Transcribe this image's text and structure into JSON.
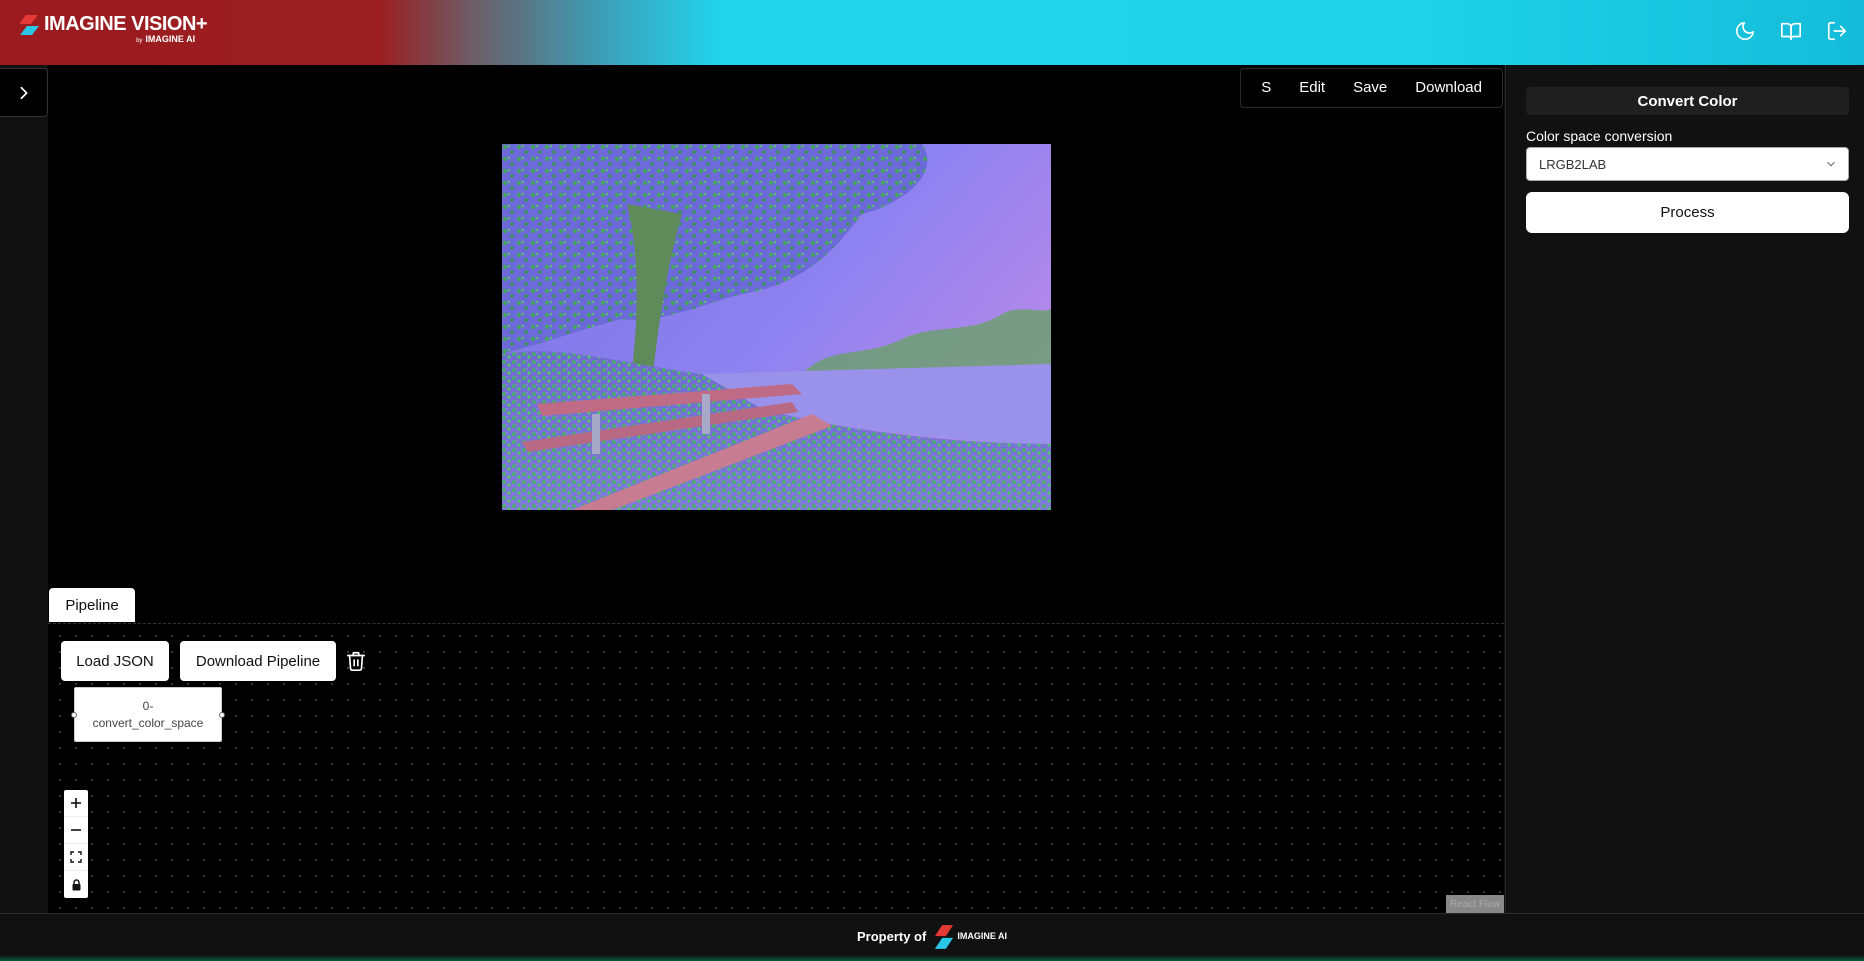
{
  "header": {
    "logo_title": "IMAGINE VISION+",
    "logo_by": "by",
    "logo_sub": "IMAGINE AI",
    "icons": [
      "moon-icon",
      "book-icon",
      "logout-icon"
    ]
  },
  "toolbar": {
    "s_label": "S",
    "edit_label": "Edit",
    "save_label": "Save",
    "download_label": "Download"
  },
  "pipeline": {
    "tab_label": "Pipeline",
    "load_json_label": "Load JSON",
    "download_pipeline_label": "Download Pipeline",
    "node_line1": "0-",
    "node_line2": "convert_color_space",
    "attribution": "React Flow"
  },
  "panel": {
    "title": "Convert Color",
    "field_label": "Color space conversion",
    "select_value": "LRGB2LAB",
    "process_label": "Process"
  },
  "footer": {
    "text": "Property of",
    "logo_text": "IMAGINE AI"
  },
  "colors": {
    "header_red": "#9b1b1f",
    "header_cyan": "#1fd3ea",
    "background": "#111111",
    "canvas": "#000000"
  }
}
